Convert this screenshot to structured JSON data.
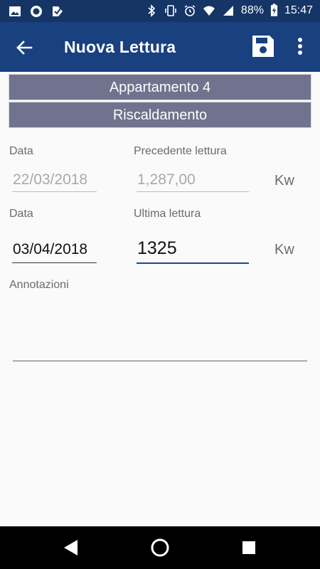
{
  "status_bar": {
    "battery": "88%",
    "time": "15:47",
    "icons": [
      "image-icon",
      "circle-app-icon",
      "check-app-icon",
      "bluetooth-icon",
      "vibrate-icon",
      "alarm-icon",
      "wifi-icon",
      "signal-icon",
      "battery-charging-icon"
    ]
  },
  "app_bar": {
    "title": "Nuova Lettura",
    "back_icon": "arrow-back-icon",
    "save_icon": "save-icon",
    "more_icon": "more-vert-icon"
  },
  "header": {
    "apartment": "Appartamento 4",
    "category": "Riscaldamento"
  },
  "previous": {
    "date_label": "Data",
    "date_value": "22/03/2018",
    "reading_label": "Precedente lettura",
    "reading_value": "1,287,00",
    "unit": "Kw"
  },
  "current": {
    "date_label": "Data",
    "date_value": "03/04/2018",
    "reading_label": "Ultima lettura",
    "reading_value": "1325",
    "unit": "Kw"
  },
  "notes": {
    "label": "Annotazioni",
    "value": ""
  },
  "nav_bar": {
    "icons": [
      "back-triangle-icon",
      "home-circle-icon",
      "recents-square-icon"
    ]
  },
  "colors": {
    "status_bar": "#153566",
    "app_bar": "#19407f",
    "header_bar": "#6f738d",
    "focus_underline": "#1b4a8c"
  }
}
